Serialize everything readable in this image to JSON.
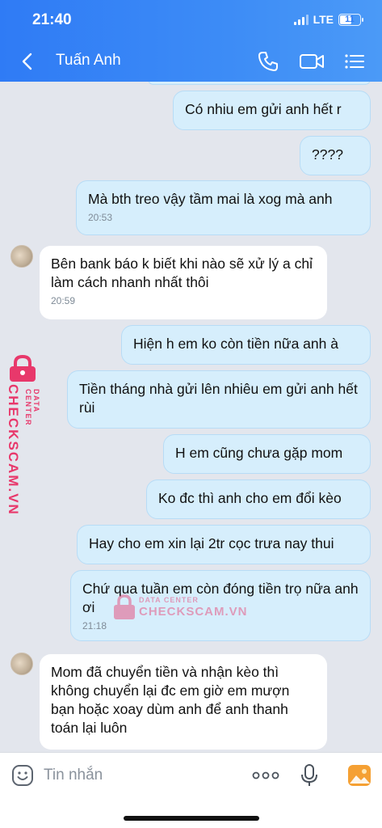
{
  "status_bar": {
    "time": "21:40",
    "network": "LTE",
    "battery": "11"
  },
  "header": {
    "contact_name": "Tuấn Anh"
  },
  "messages": [
    {
      "text": "Có nhiu em gửi anh hết r"
    },
    {
      "text": "????"
    },
    {
      "text": "Mà bth treo vậy tầm mai là xog mà anh",
      "time": "20:53"
    },
    {
      "text": "Bên bank báo k biết khi nào sẽ xử lý a chỉ làm cách nhanh nhất thôi",
      "time": "20:59"
    },
    {
      "text": "Hiện h em ko còn tiền nữa anh à"
    },
    {
      "text": "Tiền tháng nhà gửi lên nhiêu em gửi anh hết rùi"
    },
    {
      "text": "H em cũng chưa gặp mom"
    },
    {
      "text": "Ko đc thì anh cho em đổi kèo"
    },
    {
      "text": "Hay cho em xin lại 2tr cọc trưa nay thui"
    },
    {
      "text": "Chứ qua tuần em còn đóng tiền trọ nữa anh ơi",
      "time": "21:18"
    },
    {
      "text": "Mom đã chuyển tiền và nhận kèo thì không chuyển lại đc em giờ em mượn bạn hoặc xoay dùm anh để anh thanh toán lại luôn"
    }
  ],
  "watermark": {
    "main": "CHECKSCAM.VN",
    "sub": "DATA CENTER"
  },
  "input": {
    "placeholder": "Tin nhắn"
  },
  "icons": {
    "back": "chevron-left-icon",
    "call": "phone-icon",
    "video": "video-camera-icon",
    "menu": "list-icon",
    "sticker": "smiley-icon",
    "more": "more-dots-icon",
    "mic": "microphone-icon",
    "image": "image-icon"
  },
  "colors": {
    "header": "#2f7bf5",
    "my_bubble": "#d6eefc",
    "their_bubble": "#ffffff",
    "chat_bg": "#e3e6ed",
    "watermark": "#e8386b"
  }
}
